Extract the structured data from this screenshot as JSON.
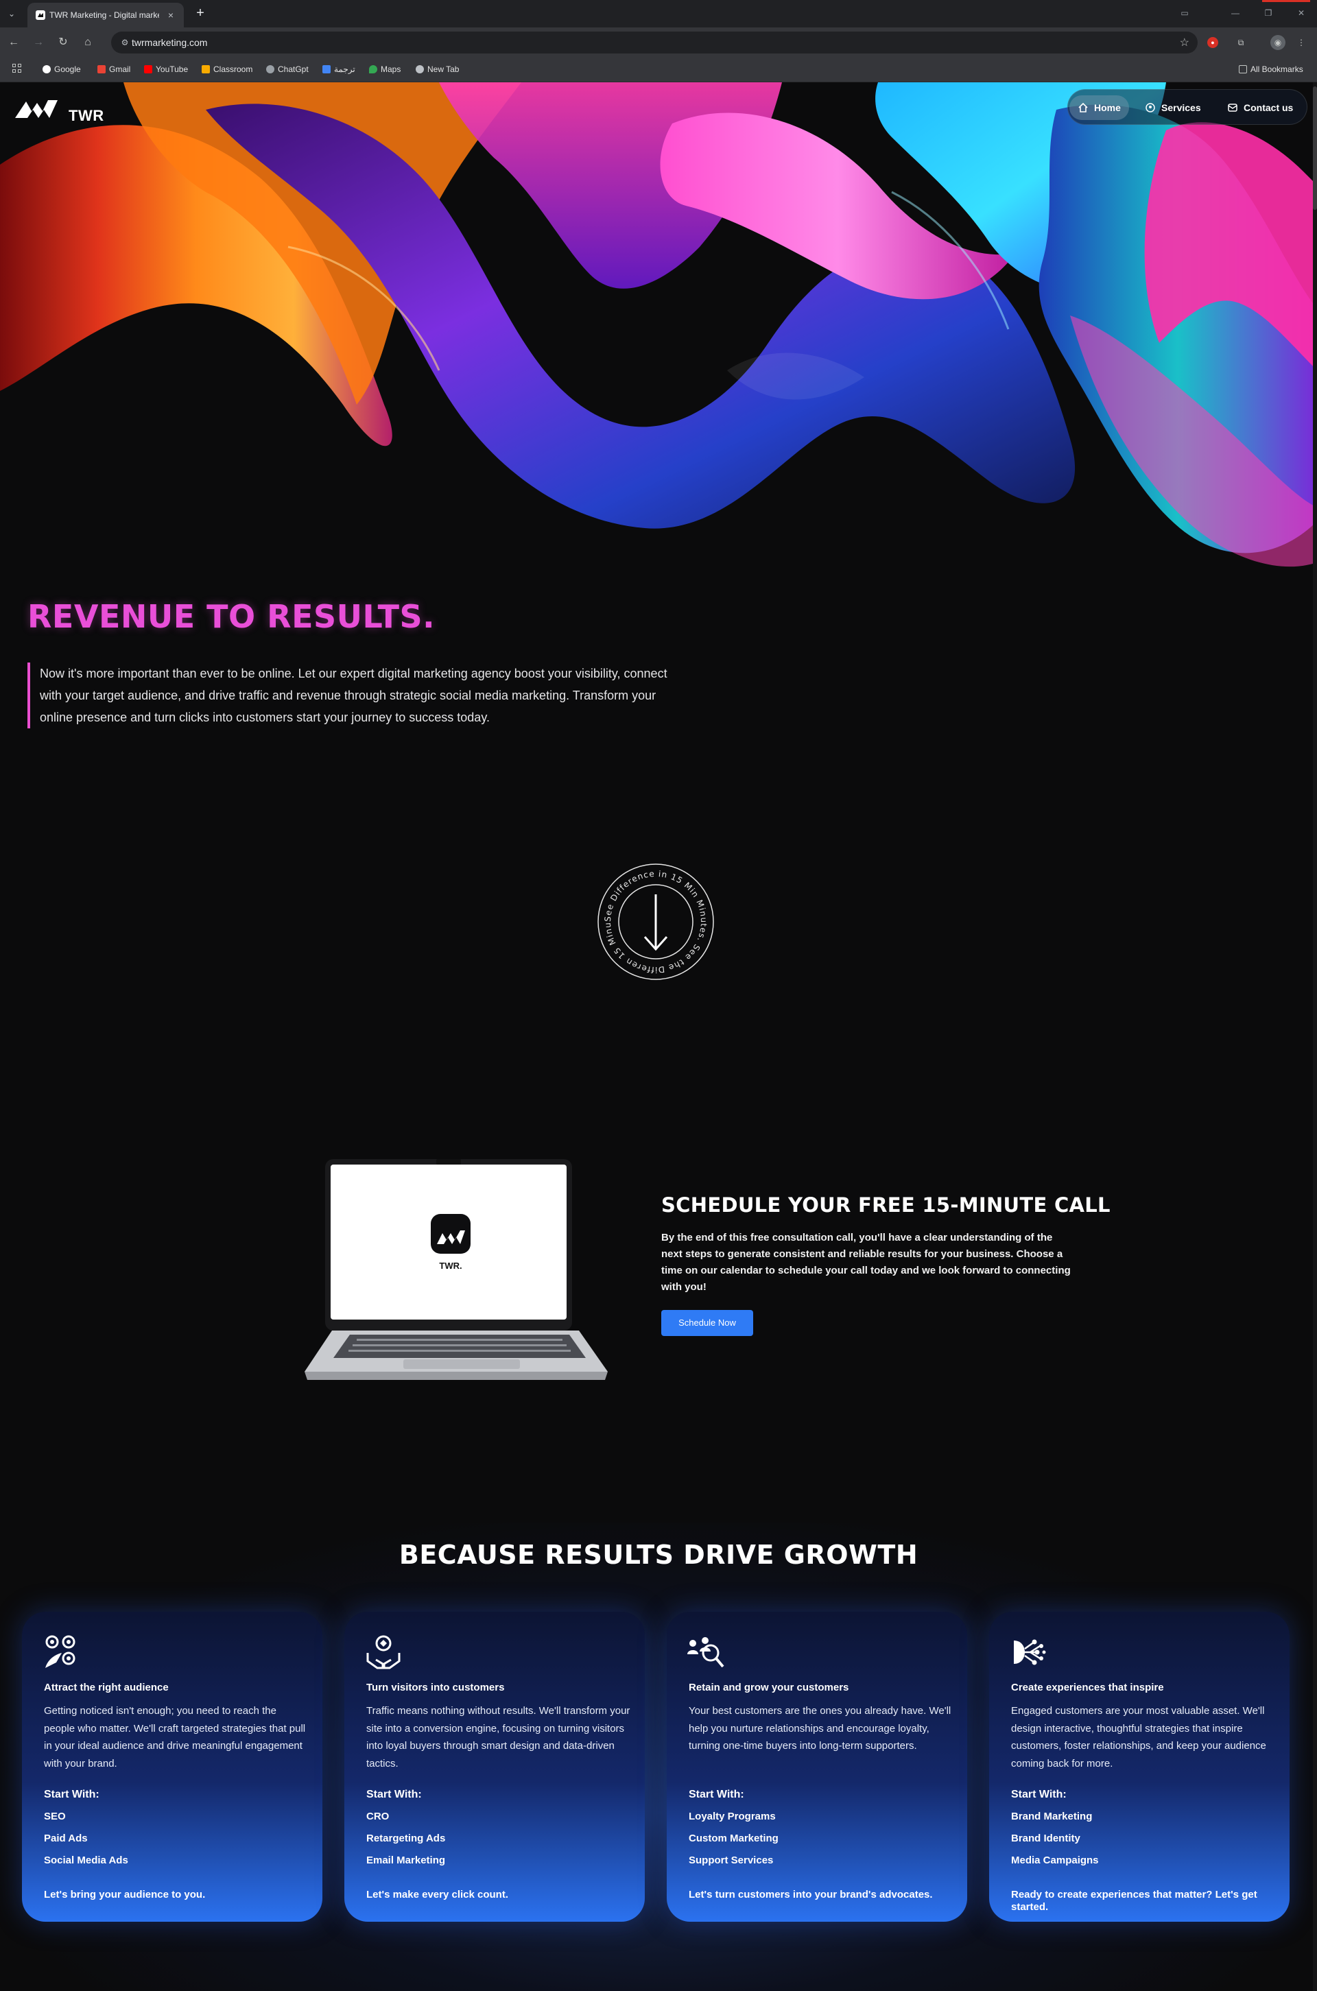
{
  "browser": {
    "tab_title": "TWR Marketing - Digital marke",
    "tab_close": "×",
    "new_tab": "+",
    "url": "twrmarketing.com",
    "bookmarks": [
      "Google",
      "Gmail",
      "YouTube",
      "Classroom",
      "ChatGpt",
      "ترجمة",
      "Maps",
      "New Tab"
    ],
    "all_bookmarks": "All Bookmarks"
  },
  "site": {
    "brand": "TWR",
    "nav": [
      "Home",
      "Services",
      "Contact us"
    ],
    "nav_active": "Home"
  },
  "hero": {
    "headline": "REVENUE TO RESULTS.",
    "intro": "Now it's more important than ever to be online. Let our expert digital marketing agency boost your visibility, connect with your target audience, and drive traffic and revenue through strategic social media marketing. Transform your online presence and turn clicks into customers start your journey to success today.",
    "badge_text": "See Difference in 15 Min Minutes. See the Differen 15 Minutes"
  },
  "schedule": {
    "laptop_label": "TWR.",
    "title": "SCHEDULE YOUR FREE 15-MINUTE CALL",
    "body": "By the end of this free consultation call, you'll have a clear understanding of the next steps to generate consistent and reliable results for your business. Choose a time on our calendar to schedule your call today and we look forward to connecting with you!",
    "button": "Schedule Now"
  },
  "growth": {
    "title": "BECAUSE RESULTS DRIVE GROWTH",
    "cards": [
      {
        "icon": "audience-icon",
        "title": "Attract the right audience",
        "body": "Getting noticed isn't enough; you need to reach the people who matter. We'll craft targeted strategies that pull in your ideal audience and drive meaningful engagement with your brand.",
        "start": "Start With:",
        "items": [
          "SEO",
          "Paid Ads",
          "Social Media Ads"
        ],
        "cta": "Let's bring your audience to you."
      },
      {
        "icon": "conversion-icon",
        "title": "Turn visitors into customers",
        "body": "Traffic means nothing without results. We'll transform your site into a conversion engine, focusing on turning visitors into loyal buyers through smart design and data-driven tactics.",
        "start": "Start With:",
        "items": [
          "CRO",
          "Retargeting Ads",
          "Email Marketing"
        ],
        "cta": "Let's make every click count."
      },
      {
        "icon": "customer-search-icon",
        "title": "Retain and grow your customers",
        "body": "Your best customers are the ones you already have. We'll help you nurture relationships and encourage loyalty, turning one-time buyers into long-term supporters.",
        "start": "Start With:",
        "items": [
          "Loyalty Programs",
          "Custom Marketing",
          "Support Services"
        ],
        "cta": "Let's turn customers into your brand's advocates."
      },
      {
        "icon": "network-icon",
        "title": "Create experiences that inspire",
        "body": "Engaged customers are your most valuable asset. We'll design interactive, thoughtful strategies that inspire customers, foster relationships, and keep your audience coming back for more.",
        "start": "Start With:",
        "items": [
          "Brand Marketing",
          "Brand Identity",
          "Media Campaigns"
        ],
        "cta": "Ready to create experiences that matter? Let's get started."
      }
    ]
  },
  "colors": {
    "headline": "#e94fd8",
    "accent_bar": "#ea4fd0",
    "button": "#2f7bf5",
    "background": "#0b0b0c"
  }
}
